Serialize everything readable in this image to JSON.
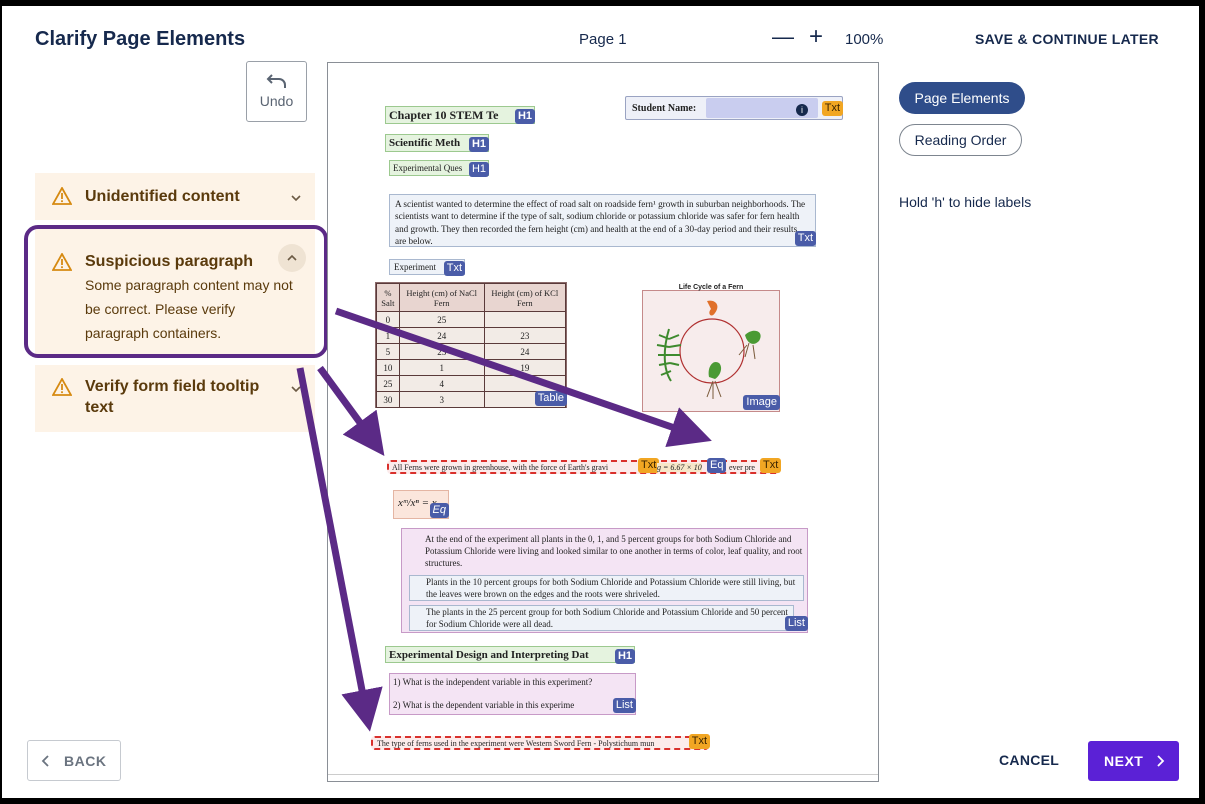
{
  "header": {
    "title": "Clarify Page Elements",
    "page_label": "Page 1",
    "zoom_minus": "—",
    "zoom_plus": "+",
    "zoom_level": "100%",
    "save_later": "SAVE & CONTINUE LATER"
  },
  "toolbar": {
    "undo_label": "Undo"
  },
  "issues": [
    {
      "title": "Unidentified content",
      "expanded": false
    },
    {
      "title": "Suspicious paragraph",
      "expanded": true,
      "description": "Some paragraph content may not be correct. Please verify paragraph containers."
    },
    {
      "title": "Verify form field tooltip text",
      "expanded": false
    }
  ],
  "right_panel": {
    "tab_page_elements": "Page Elements",
    "tab_reading_order": "Reading Order",
    "hint": "Hold 'h' to hide labels"
  },
  "footer": {
    "back": "BACK",
    "cancel": "CANCEL",
    "next": "NEXT"
  },
  "document": {
    "heading1": "Chapter 10 STEM Te",
    "student_name_label": "Student Name:",
    "heading2": "Scientific Meth",
    "heading3": "Experimental Ques",
    "paragraph": "A scientist wanted to determine the effect of road salt on roadside fern¹ growth in suburban neighborhoods. The scientists want to determine if the type of salt, sodium chloride or potassium chloride was safer for fern health and growth. They then recorded the fern height (cm) and health at the end of a 30-day period and their results are below.",
    "experiment_label": "Experiment",
    "table": {
      "headers": [
        "% Salt",
        "Height (cm) of NaCl Fern",
        "Height (cm) of KCl Fern"
      ],
      "rows": [
        [
          "0",
          "25",
          ""
        ],
        [
          "1",
          "24",
          "23"
        ],
        [
          "5",
          "23",
          "24"
        ],
        [
          "10",
          "1",
          "19"
        ],
        [
          "25",
          "4",
          ""
        ],
        [
          "30",
          "3",
          ""
        ]
      ]
    },
    "image_title": "Life Cycle of a Fern",
    "suspicious_line": "All Ferns were grown in greenhouse, with the  force of Earth's gravi",
    "equation_inline": "g = 6.67 × 10",
    "suspicious_tail": "ever pre",
    "equation_block": "xᵐ/xⁿ = x",
    "list_items": [
      "At the end of the experiment all plants in the 0, 1, and 5 percent groups for both Sodium Chloride and Potassium Chloride were living and looked similar to one another in terms of color, leaf quality, and root structures.",
      "Plants in the 10 percent groups for both Sodium Chloride and Potassium Chloride were still living, but the leaves were brown on the edges and the roots were shriveled.",
      "The plants in the 25 percent group for both Sodium Chloride and Potassium Chloride and 50 percent for Sodium Chloride were all dead."
    ],
    "heading4": "Experimental Design and Interpreting Dat",
    "questions": [
      "1)   What is the independent variable in this experiment?",
      "2)   What is the dependent variable in this experime"
    ],
    "footnote": "The type of ferns used in the experiment were Western Sword Fern - Polystichum mun",
    "tags": {
      "h1": "H1",
      "txt": "Txt",
      "table": "Table",
      "image": "Image",
      "eq": "Eq",
      "list": "List"
    }
  }
}
